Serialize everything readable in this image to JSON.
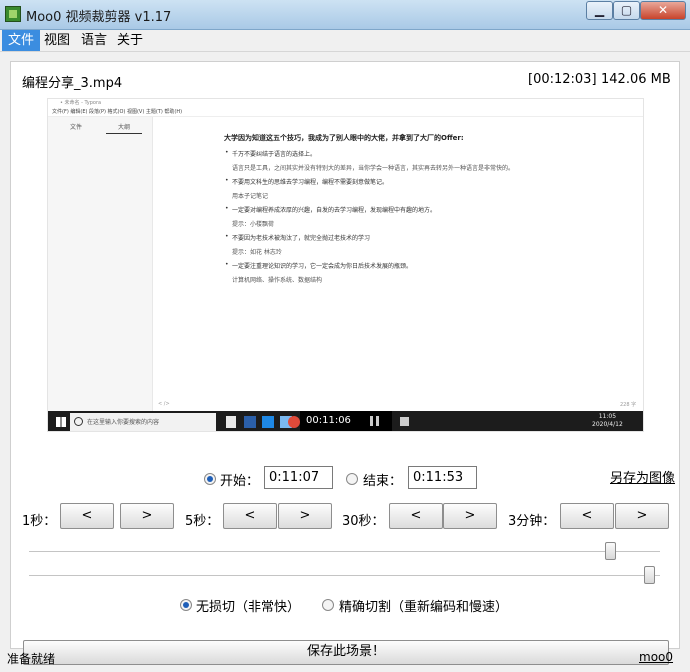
{
  "window": {
    "title": "Moo0 视频裁剪器 v1.17"
  },
  "menu": [
    "文件",
    "视图",
    "语言",
    "关于"
  ],
  "file": {
    "name": "编程分享_3.mp4",
    "duration": "[00:12:03]",
    "size": "142.06 MB"
  },
  "video": {
    "app_title": "• 未命名 - Typora",
    "app_menu": "文件(F)  编辑(E)  段落(P)  格式(O)  视图(V)  主题(T)  帮助(H)",
    "side_tabs": [
      "文件",
      "大纲"
    ],
    "heading": "大学因为知道这五个技巧，我成为了别人眼中的大佬，并拿到了大厂的Offer:",
    "items": [
      {
        "text": "千万不要纠结于语言的选择上。",
        "sub": "语言只是工具，之间其实并没有特别大的差异，当你学会一种语言，其实再去转另外一种语言是非常快的。"
      },
      {
        "text": "不要用文科生的思维去学习编程，编程不需要刻意做笔记。",
        "sub": "用本子记笔记"
      },
      {
        "text": "一定要对编程养成浓厚的兴趣，自发的去学习编程，发现编程中有趣的地方。",
        "sub": "提示：小楼飘荷"
      },
      {
        "text": "不要因为老技术被淘汰了，就完全抛过老技术的学习",
        "sub": "提示：如花  林志玲"
      },
      {
        "text": "一定要注重理论知识的学习，它一定会成为你日后技术发展的瓶颈。",
        "sub": "计算机网络、操作系统、数据结构"
      }
    ],
    "footer_left": "< />",
    "footer_right": "228 字",
    "taskbar": {
      "search_placeholder": "在这里输入你要搜索的内容",
      "play_time": "00:11:06",
      "clock_time": "11:05",
      "clock_date": "2020/4/12"
    }
  },
  "cut": {
    "start_label": "开始：",
    "start_value": "0:11:07",
    "end_label": "结束：",
    "end_value": "0:11:53",
    "selected": "start",
    "save_image": "另存为图像"
  },
  "steps": [
    {
      "label": "1秒：",
      "prev": "<",
      "next": ">"
    },
    {
      "label": "5秒：",
      "prev": "<",
      "next": ">"
    },
    {
      "label": "30秒：",
      "prev": "<",
      "next": ">"
    },
    {
      "label": "3分钟：",
      "prev": "<",
      "next": ">"
    }
  ],
  "sliders": {
    "start_fraction": 0.921,
    "end_fraction": 0.983
  },
  "mode": {
    "lossless": "无损切（非常快）",
    "precise": "精确切割（重新编码和慢速）",
    "selected": "lossless"
  },
  "save_button": "保存此场景！",
  "status": {
    "text": "准备就绪",
    "link": "moo0"
  }
}
